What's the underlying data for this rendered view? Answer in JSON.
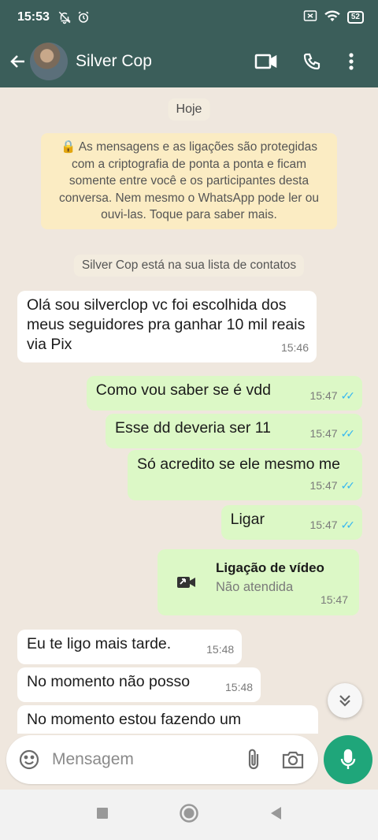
{
  "status_bar": {
    "time": "15:53",
    "battery": "52"
  },
  "header": {
    "contact_name": "Silver Cop"
  },
  "chat": {
    "date_chip": "Hoje",
    "encryption_notice": "🔒 As mensagens e as ligações são protegidas com a criptografia de ponta a ponta e ficam somente entre você e os participantes desta conversa. Nem mesmo o WhatsApp pode ler ou ouvi-las. Toque para saber mais.",
    "contact_note": "Silver Cop está na sua lista de contatos",
    "messages": [
      {
        "text": "Olá sou silverclop vc foi escolhida dos meus seguidores pra ganhar 10 mil reais via Pix",
        "time": "15:46"
      },
      {
        "text": "Como vou saber se é vdd",
        "time": "15:47"
      },
      {
        "text": "Esse dd deveria ser 11",
        "time": "15:47"
      },
      {
        "text": "Só acredito se ele mesmo me",
        "time": "15:47"
      },
      {
        "text": "Ligar",
        "time": "15:47"
      },
      {
        "text": "Eu te ligo mais tarde.",
        "time": "15:48"
      },
      {
        "text": "No momento não posso",
        "time": "15:48"
      },
      {
        "text": "No momento estou fazendo um",
        "time": ""
      }
    ],
    "call": {
      "title": "Ligação de vídeo",
      "status": "Não atendida",
      "time": "15:47"
    }
  },
  "input": {
    "placeholder": "Mensagem"
  },
  "colors": {
    "header": "#3b5e5a",
    "outgoing": "#dcf8c6",
    "incoming": "#ffffff",
    "accent": "#1fa67a",
    "ticks": "#34b7f1"
  },
  "icons": [
    "back-arrow-icon",
    "video-call-icon",
    "phone-icon",
    "more-vert-icon",
    "emoji-icon",
    "attach-icon",
    "camera-icon",
    "mic-icon",
    "scroll-down-icon",
    "video-camera-icon",
    "lock-icon"
  ]
}
